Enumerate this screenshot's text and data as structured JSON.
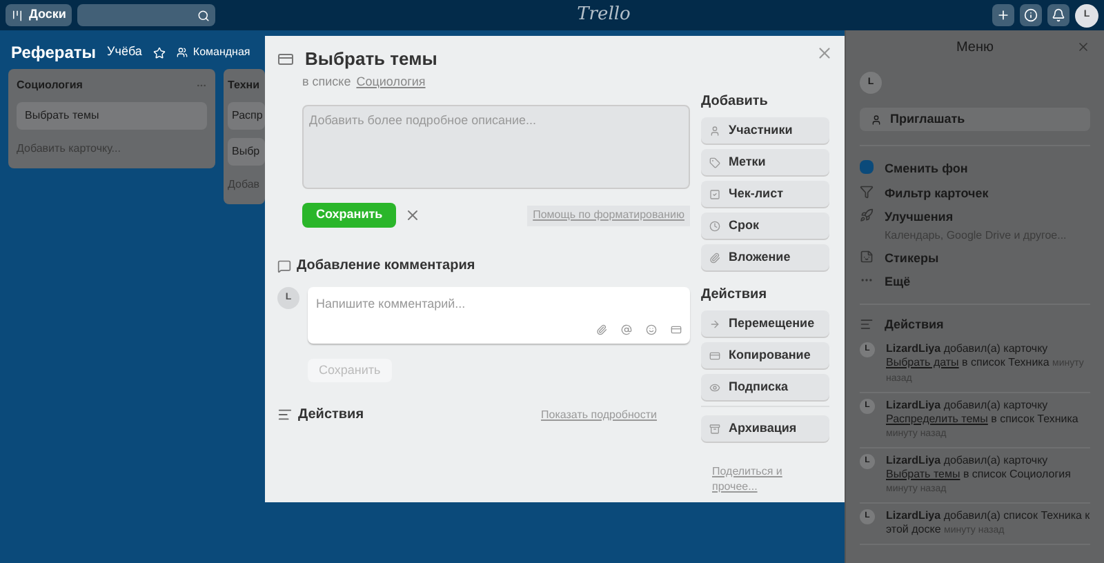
{
  "header": {
    "boards_button": "Доски",
    "logo": "Trello",
    "avatar": "L"
  },
  "board": {
    "title": "Рефераты",
    "team": "Учёба",
    "starred": false,
    "visibility": "Командная",
    "lists": [
      {
        "title": "Социология",
        "cards": [
          "Выбрать темы"
        ],
        "add": "Добавить карточку..."
      },
      {
        "title": "Техни",
        "cards": [
          "Распр",
          "Выбр"
        ],
        "add": "Добав"
      }
    ]
  },
  "menu": {
    "title": "Меню",
    "avatar": "L",
    "invite": "Приглашать",
    "items": [
      {
        "kind": "background",
        "label": "Сменить фон",
        "color": "#0b4a7a"
      },
      {
        "kind": "filter",
        "label": "Фильтр карточек"
      },
      {
        "kind": "powerups",
        "label": "Улучшения",
        "sub": "Календарь, Google Drive и другое..."
      },
      {
        "kind": "stickers",
        "label": "Стикеры"
      },
      {
        "kind": "more",
        "label": "Ещё"
      }
    ],
    "activity_title": "Действия",
    "activity": [
      {
        "avatar": "L",
        "user": "LizardLiya",
        "before": "добавил(а) карточку",
        "link": "Выбрать даты",
        "after": "в список Техника",
        "time": "минуту назад"
      },
      {
        "avatar": "L",
        "user": "LizardLiya",
        "before": "добавил(а) карточку",
        "link": "Распределить темы",
        "after": "в список Техника",
        "time": "минуту назад"
      },
      {
        "avatar": "L",
        "user": "LizardLiya",
        "before": "добавил(а) карточку",
        "link": "Выбрать темы",
        "after": "в список Социология",
        "time": "минуту назад"
      },
      {
        "avatar": "L",
        "user": "LizardLiya",
        "before": "добавил(а) список Техника к этой доске",
        "time": "минуту назад"
      }
    ]
  },
  "card": {
    "title": "Выбрать темы",
    "in_list": "в списке",
    "list_link": "Социология",
    "description": {
      "placeholder": "Добавить более подробное описание...",
      "save": "Сохранить",
      "help": "Помощь по форматированию"
    },
    "comment": {
      "title": "Добавление комментария",
      "avatar": "L",
      "placeholder": "Напишите комментарий...",
      "save": "Сохранить",
      "save_disabled": true
    },
    "activity": {
      "title": "Действия",
      "details": "Показать подробности"
    },
    "add_title": "Добавить",
    "add_buttons": [
      {
        "kind": "members",
        "label": "Участники"
      },
      {
        "kind": "labels",
        "label": "Метки"
      },
      {
        "kind": "checklist",
        "label": "Чек-лист"
      },
      {
        "kind": "due",
        "label": "Срок"
      },
      {
        "kind": "attachment",
        "label": "Вложение"
      }
    ],
    "actions_title": "Действия",
    "action_buttons": [
      {
        "kind": "move",
        "label": "Перемещение"
      },
      {
        "kind": "copy",
        "label": "Копирование"
      },
      {
        "kind": "subscribe",
        "label": "Подписка"
      },
      {
        "kind": "archive",
        "label": "Архивация"
      }
    ],
    "share": "Поделиться и прочее..."
  }
}
